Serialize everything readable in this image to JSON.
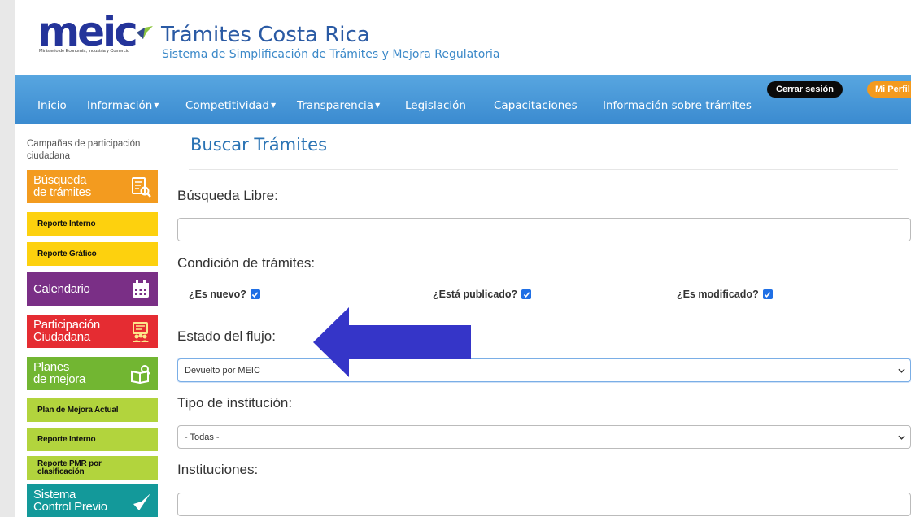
{
  "header": {
    "logo_text": "meic",
    "logo_subtitle": "Ministerio de Economía, Industria y Comercio",
    "title": "Trámites Costa Rica",
    "subtitle": "Sistema de Simplificación de Trámites y Mejora Regulatoria"
  },
  "navbar": {
    "items": [
      {
        "label": "Inicio"
      },
      {
        "label": "Información"
      },
      {
        "label": "Competitividad"
      },
      {
        "label": "Transparencia"
      },
      {
        "label": "Legislación"
      },
      {
        "label": "Capacitaciones"
      },
      {
        "label": "Información sobre trámites"
      }
    ],
    "logout_label": "Cerrar sesión",
    "profile_label": "Mi Perfil"
  },
  "sidebar": {
    "campaign_link": "Campañas de participación ciudadana",
    "tiles": [
      {
        "label": "Búsqueda\nde trámites",
        "color": "#f39b1f",
        "icon": "search-document-icon"
      },
      {
        "label": "Reporte Interno",
        "color": "#fdd10e"
      },
      {
        "label": "Reporte Gráfico",
        "color": "#fdd10e"
      },
      {
        "label": "Calendario",
        "color": "#7a2f86",
        "icon": "calendar-icon"
      },
      {
        "label": "Participación\nCiudadana",
        "color": "#e52c32",
        "icon": "participation-icon"
      },
      {
        "label": "Planes\nde mejora",
        "color": "#72b632",
        "icon": "book-search-icon"
      },
      {
        "label": "Plan de Mejora Actual",
        "color": "#b2d43d"
      },
      {
        "label": "Reporte Interno",
        "color": "#b2d43d"
      },
      {
        "label": "Reporte PMR por\nclasificación",
        "color": "#b2d43d"
      },
      {
        "label": "Sistema\nControl Previo",
        "color": "#13999a",
        "icon": "check-arrow-icon"
      }
    ]
  },
  "main": {
    "title": "Buscar Trámites",
    "free_search_label": "Búsqueda Libre:",
    "free_search_value": "",
    "condition_label": "Condición de trámites:",
    "checks": [
      {
        "label": "¿Es nuevo?",
        "checked": true
      },
      {
        "label": "¿Está publicado?",
        "checked": true
      },
      {
        "label": "¿Es modificado?",
        "checked": true
      }
    ],
    "flow_state_label": "Estado del flujo:",
    "flow_state_value": "Devuelto por MEIC",
    "institution_type_label": "Tipo de institución:",
    "institution_type_value": "- Todas -",
    "institutions_label": "Instituciones:",
    "institutions_value": ""
  },
  "colors": {
    "navbar": "#4596d6",
    "brand_blue": "#24349a",
    "title_blue": "#2a73b4",
    "arrow": "#3535c8",
    "logout": "#0a0a0a",
    "profile": "#f39a1e",
    "checkbox": "#1f6fe5"
  }
}
